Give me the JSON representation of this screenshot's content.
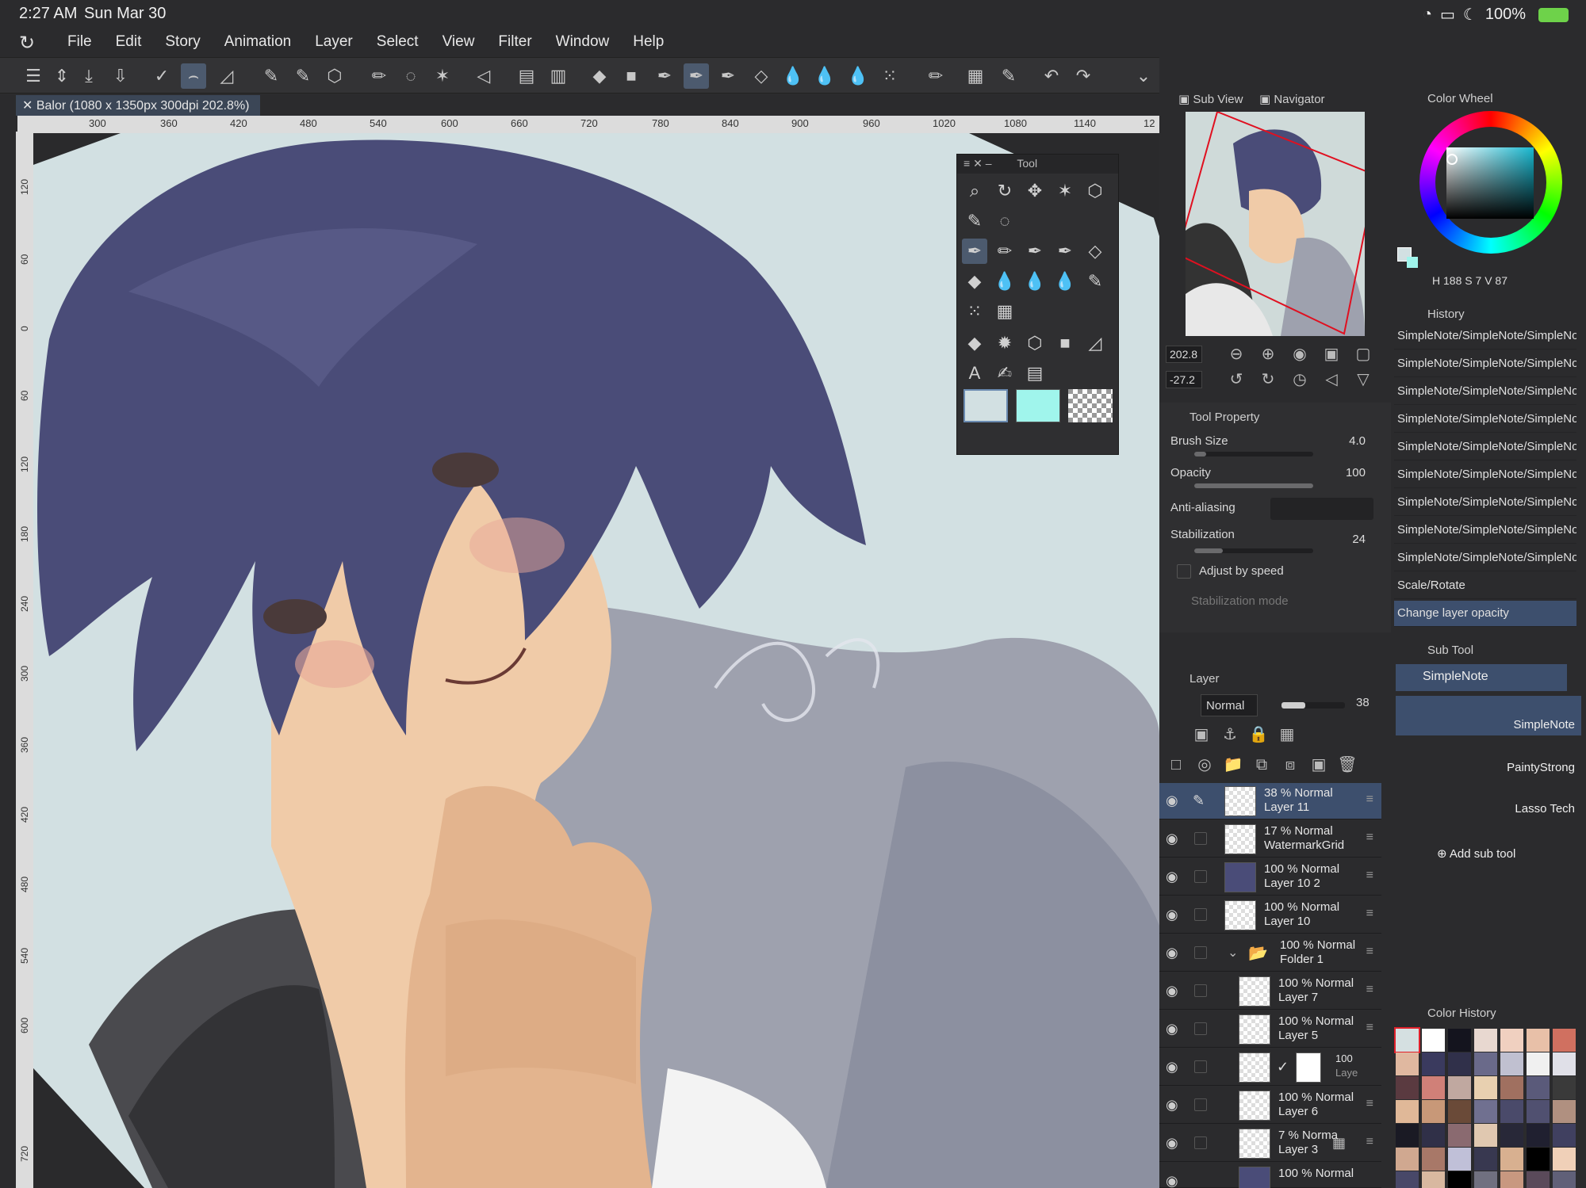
{
  "status": {
    "time": "2:27 AM",
    "date": "Sun Mar 30",
    "battery": "100%"
  },
  "menu": [
    "File",
    "Edit",
    "Story",
    "Animation",
    "Layer",
    "Select",
    "View",
    "Filter",
    "Window",
    "Help"
  ],
  "document": {
    "tab_label": "Balor (1080 x 1350px 300dpi 202.8%)"
  },
  "ruler_h": [
    "300",
    "360",
    "420",
    "480",
    "540",
    "600",
    "660",
    "720",
    "780",
    "840",
    "900",
    "960",
    "1020",
    "1080",
    "1140",
    "12"
  ],
  "ruler_v": [
    "120",
    "60",
    "0",
    "60",
    "120",
    "180",
    "240",
    "300",
    "360",
    "420",
    "480",
    "540",
    "600",
    "720"
  ],
  "tool_palette": {
    "title": "Tool"
  },
  "navigator": {
    "tab_subview": "Sub View",
    "tab_navigator": "Navigator",
    "zoom": "202.8",
    "rotation": "-27.2"
  },
  "tool_property": {
    "title": "Tool Property",
    "brush_size_label": "Brush Size",
    "brush_size": "4.0",
    "brush_size_fill": 0.1,
    "opacity_label": "Opacity",
    "opacity": "100",
    "opacity_fill": 1.0,
    "antialias_label": "Anti-aliasing",
    "stabilization_label": "Stabilization",
    "stabilization": "24",
    "stabilization_fill": 0.24,
    "adjust_label": "Adjust by speed",
    "stab_mode_label": "Stabilization mode"
  },
  "layer_panel": {
    "title": "Layer",
    "blend": "Normal",
    "opacity": "38",
    "opacity_fill": 0.38
  },
  "layers": [
    {
      "pct": "38 %",
      "mode": "Normal",
      "name": "Layer 11",
      "selected": true
    },
    {
      "pct": "17 %",
      "mode": "Normal",
      "name": "WatermarkGrid"
    },
    {
      "pct": "100 %",
      "mode": "Normal",
      "name": "Layer 10 2"
    },
    {
      "pct": "100 %",
      "mode": "Normal",
      "name": "Layer 10"
    },
    {
      "pct": "100 %",
      "mode": "Normal",
      "name": "Folder 1"
    },
    {
      "pct": "100 %",
      "mode": "Normal",
      "name": "Layer 7"
    },
    {
      "pct": "100 %",
      "mode": "Normal",
      "name": "Layer 5"
    },
    {
      "pct": "100",
      "mode": "",
      "name": "Laye"
    },
    {
      "pct": "100 %",
      "mode": "Normal",
      "name": "Layer 6"
    },
    {
      "pct": "7 %",
      "mode": "Norma",
      "name": "Layer 3"
    },
    {
      "pct": "100 %",
      "mode": "Normal",
      "name": ""
    }
  ],
  "color_wheel": {
    "title": "Color Wheel",
    "h": "188",
    "s": "7",
    "v": "87",
    "h_label": "H",
    "s_label": "S",
    "v_label": "V"
  },
  "history": {
    "title": "History",
    "items": [
      "SimpleNote/SimpleNote/SimpleNote",
      "SimpleNote/SimpleNote/SimpleNote",
      "SimpleNote/SimpleNote/SimpleNote",
      "SimpleNote/SimpleNote/SimpleNote",
      "SimpleNote/SimpleNote/SimpleNote",
      "SimpleNote/SimpleNote/SimpleNote",
      "SimpleNote/SimpleNote/SimpleNote",
      "SimpleNote/SimpleNote/SimpleNote",
      "SimpleNote/SimpleNote/SimpleNote",
      "Scale/Rotate",
      "Change layer opacity"
    ]
  },
  "sub_tool": {
    "title": "Sub Tool",
    "group": "SimpleNote",
    "items": [
      "SimpleNote",
      "PaintyStrong",
      "Lasso Tech"
    ],
    "add": "Add sub tool"
  },
  "color_history": {
    "title": "Color History",
    "swatches": [
      "#d5e0e1",
      "#ffffff",
      "#14141e",
      "#e8d8d0",
      "#f0d0c0",
      "#e8c0a8",
      "#d07060",
      "#e0b8a0",
      "#3a3a5e",
      "#30304a",
      "#6a6a8a",
      "#c0c0d0",
      "#f0f0f0",
      "#e0e0e8",
      "#5a3a40",
      "#d08078",
      "#c0a8a0",
      "#e8d0b0",
      "#a07060",
      "#5a5a7a",
      "#3a3a3a",
      "#e0b898",
      "#c89878",
      "#6a4a38",
      "#707090",
      "#4a4a6a",
      "#505070",
      "#b09080",
      "#1a1a24",
      "#303048",
      "#8a6a70",
      "#e0c8b0",
      "#282838",
      "#202030",
      "#404060",
      "#d0a890",
      "#a87868",
      "#c0c0d8",
      "#383850",
      "#d8b090",
      "#000000",
      "#f0d0b8",
      "#484868",
      "#d8b8a0",
      "#000000",
      "#707080",
      "#c89880",
      "#5a4a5a",
      "#606078"
    ]
  },
  "colors": {
    "accent": "#3d4f6d",
    "panel": "#2f2f31",
    "canvas_bg": "#d2e0e2",
    "hair": "#4a4c78",
    "skin": "#f0cba8",
    "coat": "#9ea1ae"
  }
}
